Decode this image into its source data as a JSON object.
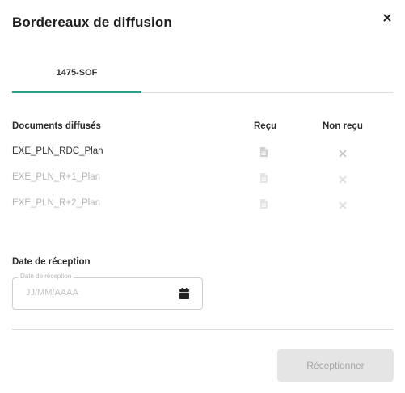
{
  "dialog": {
    "title": "Bordereaux de diffusion",
    "close_icon": "close-icon"
  },
  "tabs": [
    {
      "label": "1475-SOF",
      "active": true
    }
  ],
  "table": {
    "headers": {
      "documents": "Documents diffusés",
      "recu": "Reçu",
      "non_recu": "Non reçu"
    },
    "rows": [
      {
        "name": "EXE_PLN_RDC_Plan",
        "state": "active",
        "recu_icon": "file-icon",
        "non_recu_icon": "close-x-icon"
      },
      {
        "name": "EXE_PLN_R+1_Plan",
        "state": "disabled",
        "recu_icon": "file-icon",
        "non_recu_icon": "close-x-icon"
      },
      {
        "name": "EXE_PLN_R+2_Plan",
        "state": "disabled",
        "recu_icon": "file-icon",
        "non_recu_icon": "close-x-icon"
      }
    ]
  },
  "date": {
    "label": "Date de réception",
    "floating_label": "Date de réception",
    "placeholder": "JJ/MM/AAAA",
    "value": "",
    "icon": "calendar-icon"
  },
  "actions": {
    "submit_label": "Réceptionner",
    "submit_disabled": true
  },
  "colors": {
    "accent": "#2a9d8f",
    "muted_text": "#b5b5b5",
    "disabled_button_bg": "#e5e5e5",
    "disabled_button_text": "#a5a5a5"
  }
}
